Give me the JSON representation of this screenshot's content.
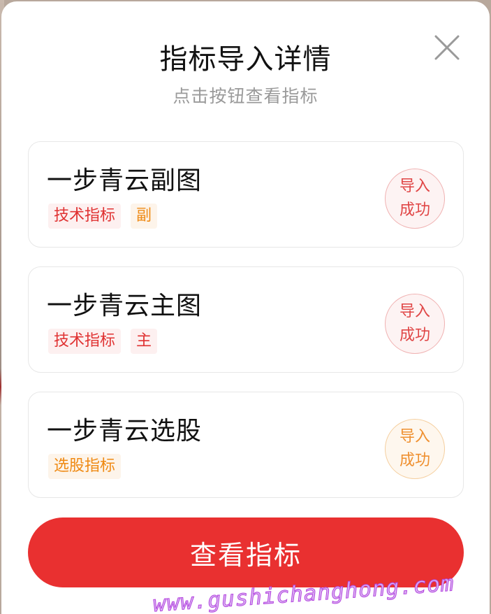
{
  "dialog": {
    "title": "指标导入详情",
    "subtitle": "点击按钮查看指标",
    "close_icon": "close-icon"
  },
  "indicators": [
    {
      "name": "一步青云副图",
      "tags": [
        {
          "label": "技术指标",
          "color": "#e03232"
        },
        {
          "label": "副",
          "color": "#ef8a14"
        }
      ],
      "status_line1": "导入",
      "status_line2": "成功",
      "status_color": "#e04646"
    },
    {
      "name": "一步青云主图",
      "tags": [
        {
          "label": "技术指标",
          "color": "#e03232"
        },
        {
          "label": "主",
          "color": "#e03232"
        }
      ],
      "status_line1": "导入",
      "status_line2": "成功",
      "status_color": "#e04646"
    },
    {
      "name": "一步青云选股",
      "tags": [
        {
          "label": "选股指标",
          "color": "#ef8a14"
        }
      ],
      "status_line1": "导入",
      "status_line2": "成功",
      "status_color": "#ef9030"
    }
  ],
  "footer": {
    "view_button_label": "查看指标",
    "button_color": "#e93030"
  },
  "watermark": {
    "text": "www.gushichanghong.com",
    "color": "#b544e0"
  }
}
